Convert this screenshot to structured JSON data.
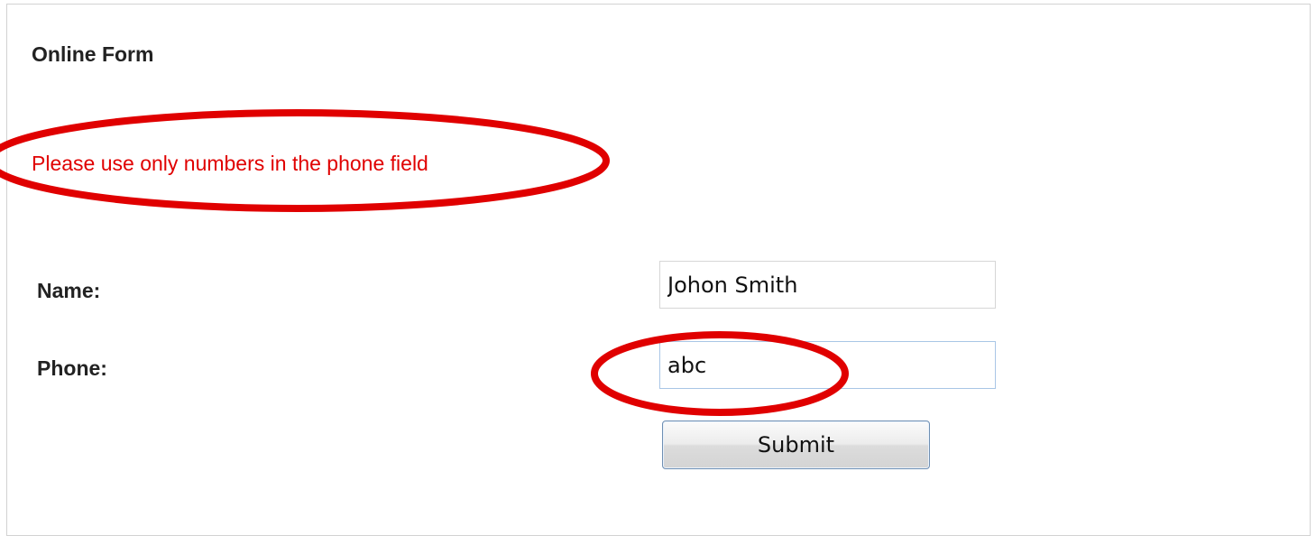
{
  "form": {
    "title": "Online Form",
    "error_message": "Please use only numbers in the phone field",
    "name_label": "Name:",
    "name_value": "Johon Smith",
    "phone_label": "Phone:",
    "phone_value": "abc",
    "submit_label": "Submit"
  },
  "colors": {
    "error": "#e00000",
    "annotation": "#e00000"
  }
}
